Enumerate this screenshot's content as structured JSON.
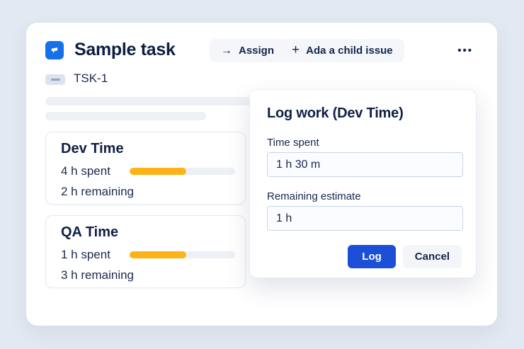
{
  "task": {
    "title": "Sample task",
    "key": "TSK-1",
    "actions": {
      "assign": "Assign",
      "add_child": "Ada a child issue"
    },
    "icons": {
      "arrow_right": "→",
      "plus": "+",
      "more": "•••"
    }
  },
  "trackers": [
    {
      "name": "Dev Time",
      "spent": "4 h spent",
      "remaining": "2 h remaining",
      "progress_percent": 54
    },
    {
      "name": "QA Time",
      "spent": "1 h spent",
      "remaining": "3 h remaining",
      "progress_percent": 54
    }
  ],
  "modal": {
    "title": "Log work (Dev Time)",
    "fields": [
      {
        "label": "Time spent",
        "value": "1 h 30 m"
      },
      {
        "label": "Remaining estimate",
        "value": "1 h"
      }
    ],
    "buttons": {
      "log": "Log",
      "cancel": "Cancel"
    }
  },
  "colors": {
    "page_background": "#e3e9f2",
    "app_icon_blue": "#1670e8",
    "accent_blue": "#1b4fd8",
    "progress_fill": "#fdb317",
    "progress_track": "#edf0f4",
    "text_navy": "#13224a"
  }
}
